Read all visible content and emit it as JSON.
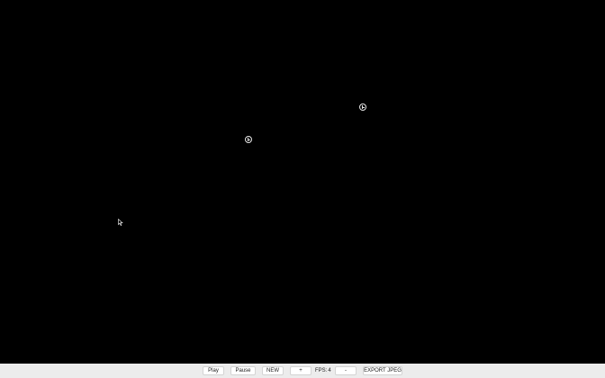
{
  "canvas": {
    "background": "#000000",
    "sprites": [
      {
        "name": "cell-sprite",
        "icon": "circle-with-b-glyph-icon"
      },
      {
        "name": "cell-sprite",
        "icon": "circle-with-b-glyph-icon"
      }
    ]
  },
  "controls": {
    "play_label": "Play",
    "pause_label": "Pause",
    "new_label": "NEW",
    "plus_label": "+",
    "fps_label": "FPS:",
    "fps_value": "4",
    "minus_label": "-",
    "export_label": "EXPORT JPEG"
  }
}
